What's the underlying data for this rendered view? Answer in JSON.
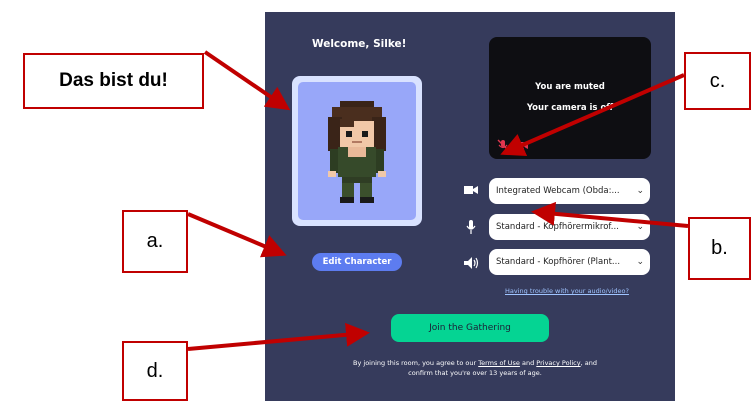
{
  "welcome": "Welcome, Silke!",
  "edit_character": "Edit Character",
  "preview": {
    "line1": "You are muted",
    "line2": "Your camera is off",
    "mic_icon": "mic-off-icon",
    "cam_icon": "camera-off-icon"
  },
  "devices": [
    {
      "icon": "video-camera-icon",
      "value": "Integrated Webcam (Obda:..."
    },
    {
      "icon": "microphone-icon",
      "value": "Standard - Kopfhörermikrof..."
    },
    {
      "icon": "speaker-icon",
      "value": "Standard - Kopfhörer (Plant..."
    }
  ],
  "trouble_link": "Having trouble with your audio/video?",
  "join_button": "Join the Gathering",
  "terms": {
    "pre": "By joining this room, you agree to our ",
    "terms_link": "Terms of Use",
    "and": " and ",
    "privacy_link": "Privacy Policy",
    "post": ", and confirm that you're over 13 years of age."
  },
  "callouts": {
    "main": "Das bist du!",
    "a": "a.",
    "b": "b.",
    "c": "c.",
    "d": "d."
  },
  "colors": {
    "panel": "#363b5c",
    "accent_blue": "#5d7cf0",
    "join_green": "#05d493",
    "callout_red": "#c00000"
  }
}
